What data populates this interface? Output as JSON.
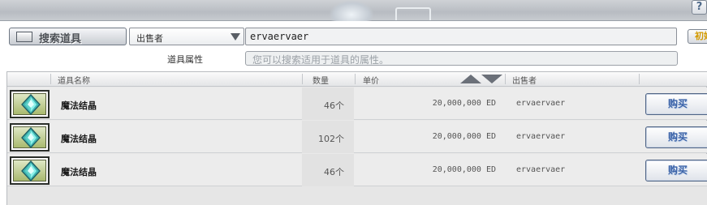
{
  "header": {
    "help_label": "?"
  },
  "search": {
    "toggle_label": "搜索道具",
    "filter_selected": "出售者",
    "filter_value": "ervaervaer",
    "reset_label": "初始化",
    "attr_label": "道具属性",
    "attr_placeholder": "您可以搜索适用于道具的属性。"
  },
  "table": {
    "columns": [
      "道具名称",
      "数量",
      "单价",
      "出售者"
    ],
    "rows": [
      {
        "icon": "diamond-gem-icon",
        "name": "魔法结晶",
        "qty": "46个",
        "price": "20,000,000 ED",
        "seller": "ervaervaer",
        "buy_label": "购买"
      },
      {
        "icon": "diamond-gem-icon",
        "name": "魔法结晶",
        "qty": "102个",
        "price": "20,000,000 ED",
        "seller": "ervaervaer",
        "buy_label": "购买"
      },
      {
        "icon": "diamond-gem-icon",
        "name": "魔法结晶",
        "qty": "46个",
        "price": "20,000,000 ED",
        "seller": "ervaervaer",
        "buy_label": "购买"
      }
    ]
  },
  "colors": {
    "buy_text": "#3b63a8",
    "reset_text": "#d39a00",
    "gem": "#5fd0c8"
  }
}
